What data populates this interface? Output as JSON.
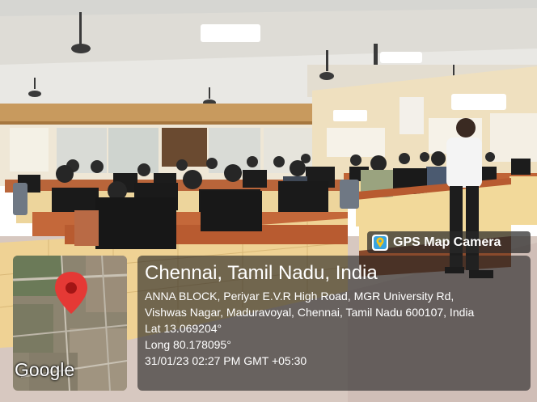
{
  "badge": {
    "label": "GPS Map Camera"
  },
  "map": {
    "brand": "Google"
  },
  "location": {
    "title": "Chennai, Tamil Nadu, India",
    "address_line1": "ANNA BLOCK, Periyar E.V.R High Road, MGR University Rd,",
    "address_line2": "Vishwas Nagar, Maduravoyal, Chennai, Tamil Nadu 600107, India",
    "lat": "Lat 13.069204°",
    "long": "Long 80.178095°",
    "datetime": "31/01/23 02:27 PM GMT +05:30"
  },
  "colors": {
    "pin_red": "#e53935",
    "overlay": "#232323",
    "wall": "#efe3c8",
    "desk_tile": "#f2d99a",
    "desk_top": "#b5592f",
    "monitor": "#1c1c1c",
    "floor": "#d7c8c0"
  }
}
